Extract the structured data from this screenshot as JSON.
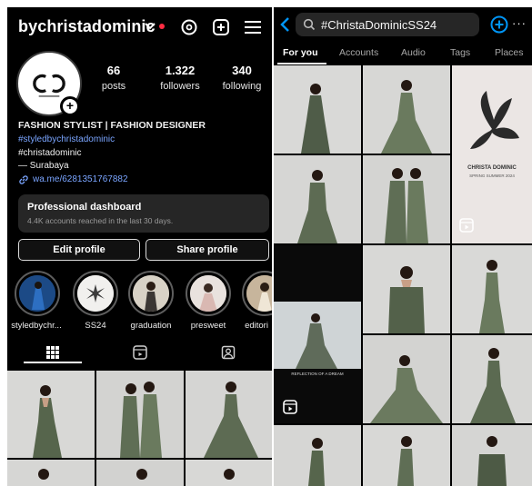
{
  "profile": {
    "username": "bychristadominic",
    "stats": [
      {
        "num": "66",
        "label": "posts"
      },
      {
        "num": "1.322",
        "label": "followers"
      },
      {
        "num": "340",
        "label": "following"
      }
    ],
    "bio": {
      "title": "FASHION STYLIST | FASHION DESIGNER",
      "link_handle": "#styledbychristadominic",
      "tag": "#christadominic",
      "location": "— Surabaya",
      "whatsapp": "wa.me/6281351767882"
    },
    "dashboard": {
      "title": "Professional dashboard",
      "subtitle": "4.4K accounts reached in the last 30 days."
    },
    "buttons": {
      "edit": "Edit profile",
      "share": "Share profile"
    },
    "highlights": [
      "styledbychr...",
      "SS24",
      "graduation",
      "presweet",
      "editori"
    ]
  },
  "search": {
    "query": "#ChristaDominicSS24",
    "tabs": [
      "For you",
      "Accounts",
      "Audio",
      "Tags",
      "Places"
    ],
    "poster_title": "CHRISTA DOMINIC",
    "poster_sub": "SPRING SUMMER 2024",
    "reel_caption": "REFLECTION OF A DREAM"
  },
  "colors": {
    "background": "#000000",
    "accent_blue": "#0095f6",
    "link_blue": "#7aa5ff",
    "notification_red": "#ff2d43",
    "dress_green": "#6a7a5e"
  },
  "icons": [
    "chevron-down-icon",
    "threads-icon",
    "plus-square-icon",
    "menu-icon",
    "link-icon",
    "grid-icon",
    "reels-icon",
    "tagged-icon",
    "back-icon",
    "search-icon",
    "add-circle-icon",
    "more-icon",
    "reel-badge-icon"
  ]
}
